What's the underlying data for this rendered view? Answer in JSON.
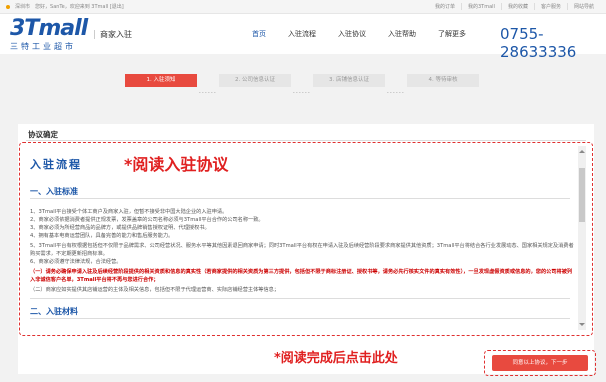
{
  "topbar": {
    "location": "深圳市",
    "greeting": "您好，SanTe，欢迎来到 3Tmall [退出]",
    "links": [
      "我的订单",
      "我的3Tmall",
      "我的收藏",
      "客户服务",
      "网站导航"
    ]
  },
  "header": {
    "logo_mark": "3Tmall",
    "logo_sub": "三特工业超市",
    "site_name": "商家入驻",
    "nav": [
      "首页",
      "入驻流程",
      "入驻协议",
      "入驻帮助",
      "了解更多"
    ],
    "phone": "0755-28633336"
  },
  "steps": [
    "1. 入驻须知",
    "2. 公司信息认证",
    "3. 店铺信息认证",
    "4. 等待审核"
  ],
  "panel": {
    "title": "协议确定",
    "heading": "入驻流程",
    "overlay_read": "*阅读入驻协议",
    "sections": {
      "s1": "一、入驻标准",
      "s2": "二、入驻材料"
    },
    "paragraphs": [
      "1、3Tmall平台接受个体工商户及商家入驻，但暂不接受非中国大陆企业的入驻申请。",
      "2、商家必须依据消费者提供正规发票，发票盖章的公司名称必须与3Tmall平台合作的公司名称一致。",
      "3、商家必须为所经营商品的品牌方，或提供品牌销售授权证明、代理授权书。",
      "4、拥有基本电商运营团队，具备完善的能力和售后服务能力。",
      "5、3Tmall平台有权根据包括但不仅限于品牌需求、公司经营状况、服务水平等其他因素退回商家申请；同时3Tmall平台有权在申请入驻及后续经营阶段要求商家提供其他资质；3Tmall平台将结合各行业发展动态、国家相关规定及消费者购买需求，不定期更新招商标准。",
      "6、商家必须遵守法律法规，合法经营。",
      "（一）请务必确保申请入驻及后续经营阶段提供的相关资质和信息的真实性（若商家提供的相关资质为第三方提供，包括但不限于商标注册证、授权书等，请务必先行核实文件的真实有效性），一旦发现虚假资质或信息的，您的公司将被列入非诚信客户名单，3Tmall平台将不再与您进行合作；",
      "（二）商家应如实提供其店铺运营的主体及相关信息，包括但不限于代理运营商、实际店铺经营主体等信息；"
    ]
  },
  "footer": {
    "overlay_click": "*阅读完成后点击此处",
    "agree_button": "同意以上协议，下一步"
  },
  "colors": {
    "brand": "#1d57a8",
    "accent": "#e84a3f",
    "annotation": "#e02020"
  }
}
